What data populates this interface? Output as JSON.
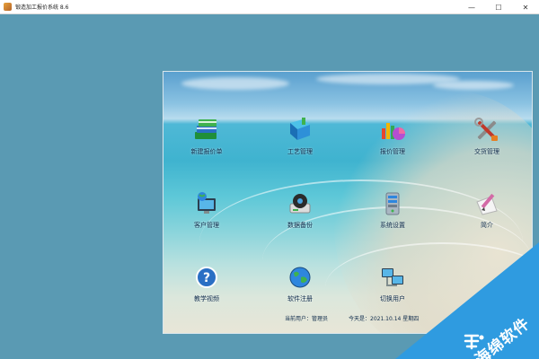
{
  "window": {
    "title": "锻造加工报价系统 8.6",
    "minimize": "—",
    "maximize": "☐",
    "close": "✕"
  },
  "tiles": [
    {
      "label": "新建报价单",
      "icon": "books-icon"
    },
    {
      "label": "工艺管理",
      "icon": "book-icon"
    },
    {
      "label": "报价管理",
      "icon": "chart-icon"
    },
    {
      "label": "交货管理",
      "icon": "tools-icon"
    },
    {
      "label": "客户管理",
      "icon": "globe-computer-icon"
    },
    {
      "label": "数据备份",
      "icon": "disk-icon"
    },
    {
      "label": "系统设置",
      "icon": "server-icon"
    },
    {
      "label": "简介",
      "icon": "pencil-paper-icon"
    },
    {
      "label": "教学视频",
      "icon": "help-icon"
    },
    {
      "label": "软件注册",
      "icon": "globe-icon"
    },
    {
      "label": "切换用户",
      "icon": "network-icon"
    }
  ],
  "status": {
    "user": "当前用户：管理员",
    "date": "今天是：2021.10.14 星期四"
  },
  "watermark": {
    "text": "海绵软件"
  },
  "colors": {
    "background": "#5a9ab3",
    "watermark": "#2f9be0"
  }
}
